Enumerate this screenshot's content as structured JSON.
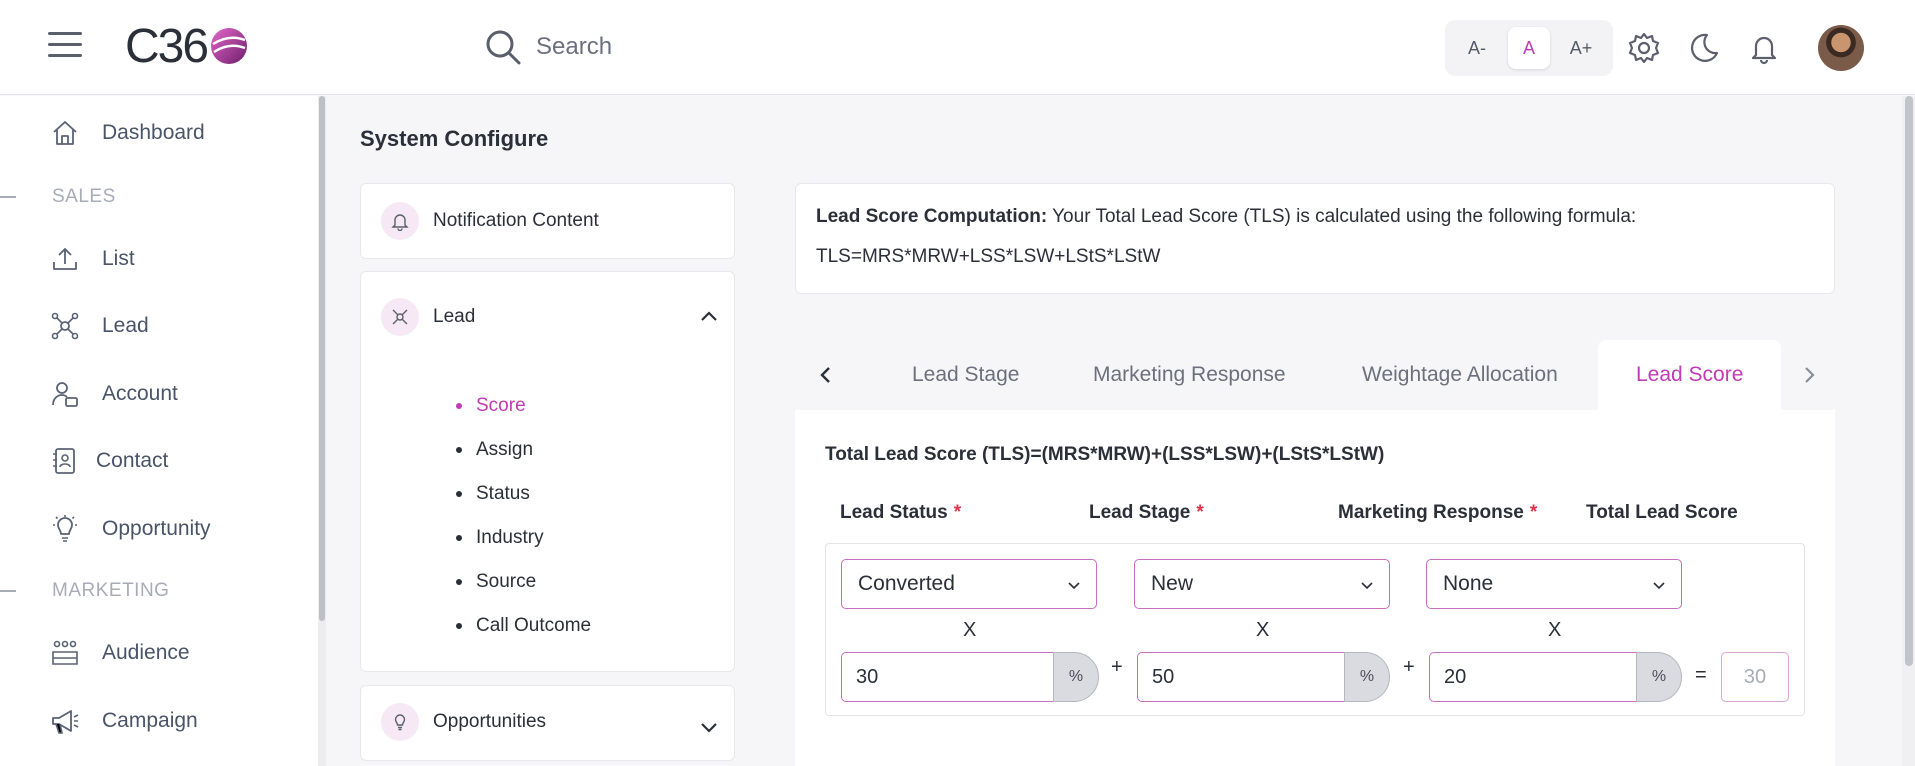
{
  "header": {
    "logo_text": "C36",
    "search_placeholder": "Search",
    "font_sizes": [
      "A-",
      "A",
      "A+"
    ],
    "active_font_size": "A",
    "icons": [
      "hamburger-icon",
      "search-icon",
      "gear-icon",
      "moon-icon",
      "bell-icon"
    ]
  },
  "sidebar": {
    "items": [
      {
        "type": "item",
        "label": "Dashboard",
        "icon": "home-icon"
      },
      {
        "type": "section",
        "label": "SALES"
      },
      {
        "type": "item",
        "label": "List",
        "icon": "upload-icon"
      },
      {
        "type": "item",
        "label": "Lead",
        "icon": "network-icon"
      },
      {
        "type": "item",
        "label": "Account",
        "icon": "user-card-icon"
      },
      {
        "type": "item",
        "label": "Contact",
        "icon": "contact-book-icon"
      },
      {
        "type": "item",
        "label": "Opportunity",
        "icon": "bulb-icon"
      },
      {
        "type": "section",
        "label": "MARKETING"
      },
      {
        "type": "item",
        "label": "Audience",
        "icon": "group-icon"
      },
      {
        "type": "item",
        "label": "Campaign",
        "icon": "megaphone-icon"
      }
    ]
  },
  "page": {
    "title": "System Configure"
  },
  "config_menu": {
    "notification": "Notification Content",
    "lead": "Lead",
    "lead_subitems": [
      "Score",
      "Assign",
      "Status",
      "Industry",
      "Source",
      "Call Outcome"
    ],
    "active_subitem": "Score",
    "opportunities": "Opportunities"
  },
  "formula": {
    "heading": "Lead Score Computation:",
    "text": "Your Total Lead Score (TLS) is calculated using the following formula:",
    "expression": "TLS=MRS*MRW+LSS*LSW+LStS*LStW"
  },
  "tabs": {
    "items": [
      "Lead Stage",
      "Marketing Response",
      "Weightage Allocation",
      "Lead Score"
    ],
    "active": "Lead Score"
  },
  "lead_score": {
    "title": "Total Lead Score (TLS)=(MRS*MRW)+(LSS*LSW)+(LStS*LStW)",
    "columns": {
      "lead_status": "Lead Status",
      "lead_stage": "Lead Stage",
      "marketing_response": "Marketing Response",
      "total": "Total Lead Score"
    },
    "required_mark": "*",
    "selects": {
      "lead_status": "Converted",
      "lead_stage": "New",
      "marketing_response": "None"
    },
    "multiply_mark": "X",
    "weights": {
      "lead_status": "30",
      "lead_stage": "50",
      "marketing_response": "20"
    },
    "percent_sign": "%",
    "plus": "+",
    "equals": "=",
    "total_value": "30"
  },
  "colors": {
    "accent": "#c13bb4",
    "required": "#e0334a"
  }
}
